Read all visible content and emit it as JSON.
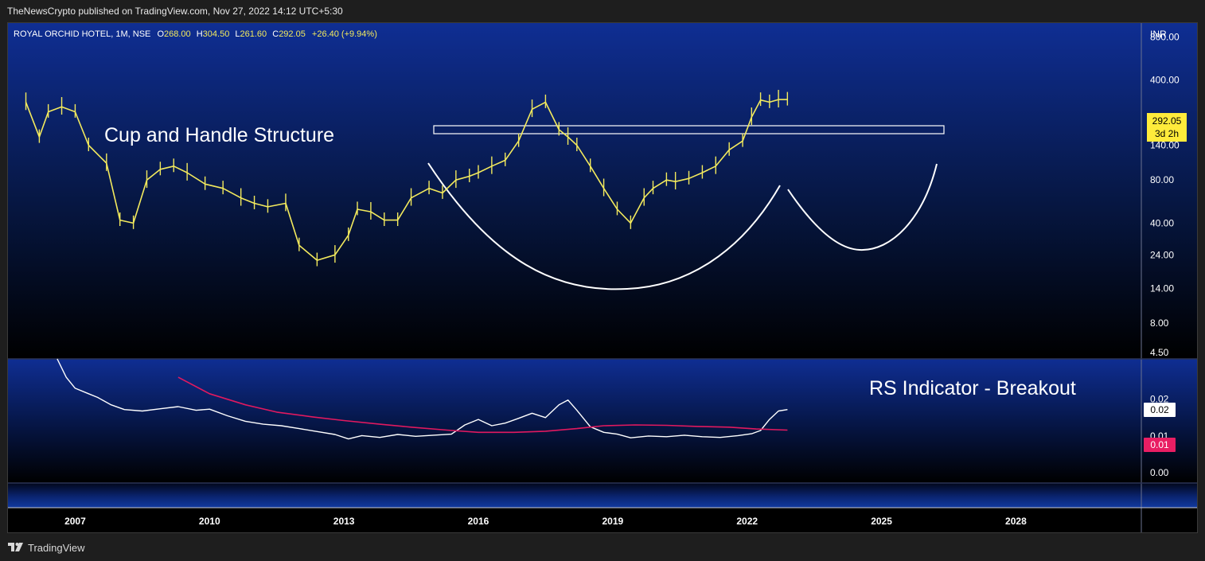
{
  "header": {
    "published": "TheNewsCrypto published on TradingView.com, Nov 27, 2022 14:12 UTC+5:30"
  },
  "legend": {
    "symbol": "ROYAL ORCHID HOTEL, 1M, NSE",
    "o_label": "O",
    "o_value": "268.00",
    "h_label": "H",
    "h_value": "304.50",
    "l_label": "L",
    "l_value": "261.60",
    "c_label": "C",
    "c_value": "292.05",
    "change": "+26.40 (+9.94%)"
  },
  "colors": {
    "price": "#f3ea5d",
    "rs_line": "#ffffff",
    "rs_ma": "#e0195f",
    "price_tag_bg": "#ffeb3b",
    "ma_tag_bg": "#e91e63",
    "drawing": "#ffffff",
    "panel_top_blue": "#0f2e93"
  },
  "chart_data": [
    {
      "type": "line",
      "subtype": "candlestick-approximation",
      "title": "ROYAL ORCHID HOTEL, 1M, NSE",
      "scale": "log",
      "currency_label": "INR",
      "y_ticks": [
        "800.00",
        "400.00",
        "140.00",
        "80.00",
        "40.00",
        "24.00",
        "14.00",
        "8.00",
        "4.50"
      ],
      "ylim": [
        4.5,
        1000
      ],
      "x_ticks": [
        "2007",
        "2010",
        "2013",
        "2016",
        "2019",
        "2022",
        "2025",
        "2028"
      ],
      "xlim": [
        2005.5,
        2030.8
      ],
      "series": [
        {
          "name": "",
          "x": [
            2005.9,
            2006.2,
            2006.4,
            2006.7,
            2007.0,
            2007.3,
            2007.7,
            2008.0,
            2008.3,
            2008.6,
            2008.9,
            2009.2,
            2009.5,
            2009.9,
            2010.3,
            2010.7,
            2011.0,
            2011.3,
            2011.7,
            2012.0,
            2012.4,
            2012.8,
            2013.1,
            2013.3,
            2013.6,
            2013.9,
            2014.2,
            2014.5,
            2014.9,
            2015.2,
            2015.5,
            2015.8,
            2016.0,
            2016.3,
            2016.6,
            2016.9,
            2017.2,
            2017.5,
            2017.8,
            2018.0,
            2018.2,
            2018.5,
            2018.8,
            2019.1,
            2019.4,
            2019.7,
            2019.9,
            2020.2,
            2020.4,
            2020.7,
            2021.0,
            2021.3,
            2021.6,
            2021.9,
            2022.1,
            2022.3,
            2022.5,
            2022.7,
            2022.9
          ],
          "values": [
            280,
            160,
            240,
            260,
            240,
            140,
            105,
            42,
            40,
            80,
            95,
            100,
            90,
            75,
            70,
            60,
            55,
            52,
            55,
            28,
            22,
            24,
            33,
            50,
            48,
            42,
            42,
            60,
            70,
            65,
            80,
            85,
            90,
            100,
            110,
            150,
            250,
            280,
            180,
            160,
            140,
            100,
            70,
            50,
            40,
            60,
            70,
            80,
            78,
            82,
            90,
            100,
            130,
            150,
            220,
            290,
            280,
            292.05,
            292.05
          ]
        }
      ],
      "last_value_tag": "292.05",
      "time_to_close": "3d 2h",
      "annotations": [
        "Cup and Handle Structure"
      ]
    },
    {
      "type": "line",
      "title": "",
      "y_ticks": [
        "0.02",
        "0.01",
        "0.00"
      ],
      "x_ticks": [
        "2007",
        "2010",
        "2013",
        "2016",
        "2019",
        "2022",
        "2025",
        "2028"
      ],
      "xlim": [
        2005.5,
        2030.8
      ],
      "series": [
        {
          "name": "",
          "x": [
            2006.6,
            2006.8,
            2007.0,
            2007.3,
            2007.5,
            2007.8,
            2008.1,
            2008.5,
            2008.9,
            2009.3,
            2009.7,
            2010.0,
            2010.4,
            2010.8,
            2011.2,
            2011.6,
            2012.0,
            2012.4,
            2012.8,
            2013.1,
            2013.4,
            2013.8,
            2014.2,
            2014.6,
            2015.0,
            2015.4,
            2015.7,
            2016.0,
            2016.3,
            2016.6,
            2016.9,
            2017.2,
            2017.5,
            2017.8,
            2018.0,
            2018.2,
            2018.5,
            2018.8,
            2019.1,
            2019.4,
            2019.8,
            2020.2,
            2020.6,
            2021.0,
            2021.4,
            2021.8,
            2022.1,
            2022.3,
            2022.5,
            2022.7,
            2022.9
          ],
          "values": [
            0.031,
            0.026,
            0.023,
            0.0215,
            0.0205,
            0.0185,
            0.0172,
            0.0168,
            0.0174,
            0.018,
            0.017,
            0.0173,
            0.0155,
            0.014,
            0.0132,
            0.0128,
            0.012,
            0.0112,
            0.0104,
            0.0092,
            0.0101,
            0.0096,
            0.0104,
            0.0099,
            0.0102,
            0.0105,
            0.013,
            0.0145,
            0.0128,
            0.0135,
            0.0148,
            0.0162,
            0.015,
            0.0185,
            0.0198,
            0.017,
            0.0125,
            0.011,
            0.0105,
            0.0095,
            0.01,
            0.0098,
            0.0102,
            0.0098,
            0.0096,
            0.0101,
            0.0106,
            0.0115,
            0.0145,
            0.0168,
            0.0172
          ]
        },
        {
          "name": "",
          "x": [
            2009.3,
            2010.0,
            2010.8,
            2011.5,
            2012.3,
            2013.0,
            2013.8,
            2014.5,
            2015.3,
            2016.0,
            2016.8,
            2017.5,
            2018.2,
            2018.8,
            2019.5,
            2020.2,
            2020.9,
            2021.6,
            2022.2,
            2022.9
          ],
          "values": [
            0.026,
            0.0215,
            0.0185,
            0.0165,
            0.0152,
            0.0142,
            0.0132,
            0.0124,
            0.0116,
            0.011,
            0.011,
            0.0113,
            0.012,
            0.0128,
            0.013,
            0.0129,
            0.0126,
            0.0124,
            0.0119,
            0.0116
          ]
        }
      ],
      "last_value_tags": [
        "0.02",
        "0.01"
      ],
      "annotations": [
        "RS Indicator - Breakout"
      ]
    }
  ],
  "footer": {
    "brand": "TradingView"
  }
}
